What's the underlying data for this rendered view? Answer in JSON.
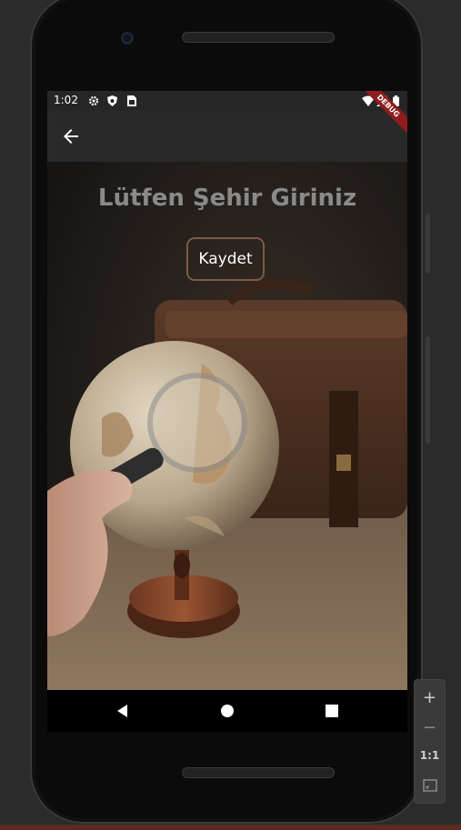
{
  "status_bar": {
    "time": "1:02"
  },
  "page": {
    "title": "Lütfen Şehir Giriniz",
    "save_label": "Kaydet"
  },
  "debug_banner": "DEBUG",
  "zoom_controls": {
    "zoom_in": "+",
    "zoom_out": "−",
    "actual_size": "1:1"
  },
  "colors": {
    "button_border": "#7b5a48",
    "title": "#8a8a8a",
    "debug_banner": "#8f1d1d"
  }
}
